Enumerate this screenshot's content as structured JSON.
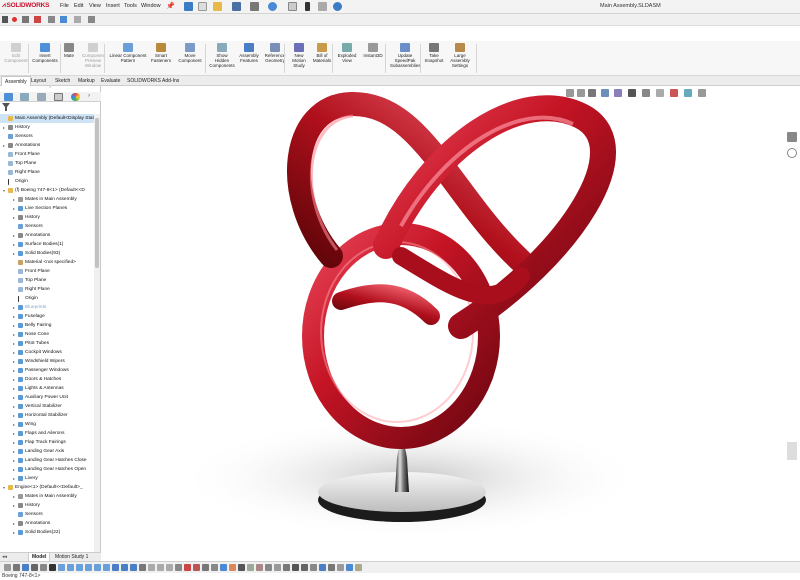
{
  "app": {
    "logo": "SOLIDWORKS",
    "document_title": "Main Assembly.SLDASM"
  },
  "menu": [
    "File",
    "Edit",
    "View",
    "Insert",
    "Tools",
    "Window"
  ],
  "command_manager": [
    {
      "label": "Edit\nComponent",
      "icon": "edit-component-icon",
      "enabled": false
    },
    {
      "label": "Insert\nComponents",
      "icon": "insert-components-icon",
      "enabled": true
    },
    {
      "label": "Mate",
      "icon": "mate-icon",
      "enabled": true
    },
    {
      "label": "Component\nPreview\nWindow",
      "icon": "component-preview-icon",
      "enabled": false
    },
    {
      "label": "Linear Component\nPattern",
      "icon": "linear-pattern-icon",
      "enabled": true
    },
    {
      "label": "Smart\nFasteners",
      "icon": "smart-fasteners-icon",
      "enabled": true
    },
    {
      "label": "Move\nComponent",
      "icon": "move-component-icon",
      "enabled": true
    },
    {
      "label": "Show\nHidden\nComponents",
      "icon": "show-hidden-icon",
      "enabled": true
    },
    {
      "label": "Assembly\nFeatures",
      "icon": "assembly-features-icon",
      "enabled": true
    },
    {
      "label": "Reference\nGeometry",
      "icon": "reference-geometry-icon",
      "enabled": true
    },
    {
      "label": "New\nMotion\nStudy",
      "icon": "motion-study-icon",
      "enabled": true
    },
    {
      "label": "Bill of\nMaterials",
      "icon": "bom-icon",
      "enabled": true
    },
    {
      "label": "Exploded\nView",
      "icon": "exploded-view-icon",
      "enabled": true
    },
    {
      "label": "Instant3D",
      "icon": "instant3d-icon",
      "enabled": true
    },
    {
      "label": "Update\nSpeedPak\nSubassemblies",
      "icon": "speedpak-icon",
      "enabled": true
    },
    {
      "label": "Take\nSnapshot",
      "icon": "snapshot-icon",
      "enabled": true
    },
    {
      "label": "Large\nAssembly\nSettings",
      "icon": "large-assembly-icon",
      "enabled": true
    }
  ],
  "tabs": [
    "Assembly",
    "Layout",
    "Sketch",
    "Markup",
    "Evaluate",
    "SOLIDWORKS Add-Ins"
  ],
  "active_tab": "Assembly",
  "tree": [
    {
      "label": "Main Assembly  (Default<Display Stat",
      "level": 0,
      "arrow": "",
      "icon": "assembly-icon",
      "selected": true
    },
    {
      "label": "History",
      "level": 0,
      "arrow": "▸",
      "icon": "history-icon"
    },
    {
      "label": "Sensors",
      "level": 0,
      "arrow": "",
      "icon": "sensors-icon"
    },
    {
      "label": "Annotations",
      "level": 0,
      "arrow": "▸",
      "icon": "annotations-icon"
    },
    {
      "label": "Front Plane",
      "level": 0,
      "arrow": "",
      "icon": "plane-icon"
    },
    {
      "label": "Top Plane",
      "level": 0,
      "arrow": "",
      "icon": "plane-icon"
    },
    {
      "label": "Right Plane",
      "level": 0,
      "arrow": "",
      "icon": "plane-icon"
    },
    {
      "label": "Origin",
      "level": 0,
      "arrow": "",
      "icon": "origin-icon"
    },
    {
      "label": "(f) Boeing 747-8<1> (Default<<D",
      "level": 0,
      "arrow": "▾",
      "icon": "part-icon"
    },
    {
      "label": "Mates in Main Assembly",
      "level": 1,
      "arrow": "▸",
      "icon": "mates-icon"
    },
    {
      "label": "Live Section Planes",
      "level": 1,
      "arrow": "▸",
      "icon": "folder-icon"
    },
    {
      "label": "History",
      "level": 1,
      "arrow": "▸",
      "icon": "history-icon"
    },
    {
      "label": "Sensors",
      "level": 1,
      "arrow": "",
      "icon": "sensors-icon"
    },
    {
      "label": "Annotations",
      "level": 1,
      "arrow": "▸",
      "icon": "annotations-icon"
    },
    {
      "label": "Surface Bodies(1)",
      "level": 1,
      "arrow": "▸",
      "icon": "folder-icon"
    },
    {
      "label": "Solid Bodies(93)",
      "level": 1,
      "arrow": "▸",
      "icon": "folder-icon"
    },
    {
      "label": "Material <not specified>",
      "level": 1,
      "arrow": "",
      "icon": "material-icon"
    },
    {
      "label": "Front Plane",
      "level": 1,
      "arrow": "",
      "icon": "plane-icon"
    },
    {
      "label": "Top Plane",
      "level": 1,
      "arrow": "",
      "icon": "plane-icon"
    },
    {
      "label": "Right Plane",
      "level": 1,
      "arrow": "",
      "icon": "plane-icon"
    },
    {
      "label": "Origin",
      "level": 1,
      "arrow": "",
      "icon": "origin-icon"
    },
    {
      "label": "Blueprints",
      "level": 1,
      "arrow": "▸",
      "icon": "folder-icon",
      "dim": true
    },
    {
      "label": "Fuselage",
      "level": 1,
      "arrow": "▸",
      "icon": "folder-icon"
    },
    {
      "label": "Belly Fairing",
      "level": 1,
      "arrow": "▸",
      "icon": "folder-icon"
    },
    {
      "label": "Nose Cone",
      "level": 1,
      "arrow": "▸",
      "icon": "folder-icon"
    },
    {
      "label": "Pitot Tubes",
      "level": 1,
      "arrow": "▸",
      "icon": "folder-icon"
    },
    {
      "label": "Cockpit Windows",
      "level": 1,
      "arrow": "▸",
      "icon": "folder-icon"
    },
    {
      "label": "Windshield Wipers",
      "level": 1,
      "arrow": "▸",
      "icon": "folder-icon"
    },
    {
      "label": "Passenger Windows",
      "level": 1,
      "arrow": "▸",
      "icon": "folder-icon"
    },
    {
      "label": "Doors & Hatches",
      "level": 1,
      "arrow": "▸",
      "icon": "folder-icon"
    },
    {
      "label": "Lights & Antennas",
      "level": 1,
      "arrow": "▸",
      "icon": "folder-icon"
    },
    {
      "label": "Auxiliary Power Unit",
      "level": 1,
      "arrow": "▸",
      "icon": "folder-icon"
    },
    {
      "label": "Vertical Stabilizer",
      "level": 1,
      "arrow": "▸",
      "icon": "folder-icon"
    },
    {
      "label": "Horizontal Stabilizer",
      "level": 1,
      "arrow": "▸",
      "icon": "folder-icon"
    },
    {
      "label": "Wing",
      "level": 1,
      "arrow": "▸",
      "icon": "folder-icon"
    },
    {
      "label": "Flaps and Ailerons",
      "level": 1,
      "arrow": "▸",
      "icon": "folder-icon"
    },
    {
      "label": "Flap Track Fairings",
      "level": 1,
      "arrow": "▸",
      "icon": "folder-icon"
    },
    {
      "label": "Landing Gear Axis",
      "level": 1,
      "arrow": "▸",
      "icon": "folder-icon"
    },
    {
      "label": "Landing Gear Hatches Close",
      "level": 1,
      "arrow": "▸",
      "icon": "folder-icon"
    },
    {
      "label": "Landing Gear Hatches Open",
      "level": 1,
      "arrow": "▸",
      "icon": "folder-icon"
    },
    {
      "label": "Livery",
      "level": 1,
      "arrow": "▸",
      "icon": "folder-icon"
    },
    {
      "label": "Engine<1> (Default<<Default>_",
      "level": 0,
      "arrow": "▾",
      "icon": "part-icon"
    },
    {
      "label": "Mates in Main Assembly",
      "level": 1,
      "arrow": "▸",
      "icon": "mates-icon"
    },
    {
      "label": "History",
      "level": 1,
      "arrow": "▸",
      "icon": "history-icon"
    },
    {
      "label": "Sensors",
      "level": 1,
      "arrow": "",
      "icon": "sensors-icon"
    },
    {
      "label": "Annotations",
      "level": 1,
      "arrow": "▸",
      "icon": "annotations-icon"
    },
    {
      "label": "Solid Bodies(22)",
      "level": 1,
      "arrow": "▸",
      "icon": "folder-icon"
    }
  ],
  "bottom_tabs": [
    "Model",
    "Motion Study 1"
  ],
  "status_text": "Boeing 747-8<1>",
  "colors": {
    "accent": "#c8102e",
    "knot_red": "#c41424",
    "folder": "#5b9bd5",
    "selection": "#cfe3f7"
  }
}
